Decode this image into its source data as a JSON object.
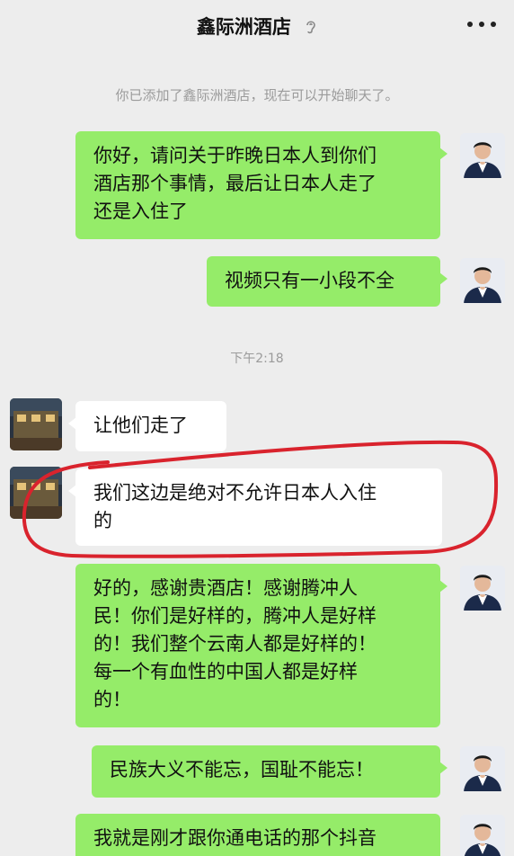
{
  "header": {
    "title": "鑫际洲酒店",
    "icon": "ear-icon",
    "more_icon": "more-icon"
  },
  "system_notice": "你已添加了鑫际洲酒店，现在可以开始聊天了。",
  "timestamp": "下午2:18",
  "messages": [
    {
      "sender": "me",
      "text": "你好，请问关于昨晚日本人到你们\n酒店那个事情，最后让日本人走了\n还是入住了"
    },
    {
      "sender": "me",
      "text": "视频只有一小段不全"
    },
    {
      "sender": "hotel",
      "text": "让他们走了"
    },
    {
      "sender": "hotel",
      "text": "我们这边是绝对不允许日本人入住\n的"
    },
    {
      "sender": "me",
      "text": "好的，感谢贵酒店！感谢腾冲人\n民！你们是好样的，腾冲人是好样\n的！我们整个云南人都是好样的！\n每一个有血性的中国人都是好样\n的！"
    },
    {
      "sender": "me",
      "text": "民族大义不能忘，国耻不能忘！"
    },
    {
      "sender": "me",
      "text": "我就是刚才跟你通电话的那个抖音"
    }
  ],
  "colors": {
    "background": "#ededed",
    "my_bubble": "#95ec69",
    "their_bubble": "#ffffff",
    "annotation": "#d9232d"
  }
}
